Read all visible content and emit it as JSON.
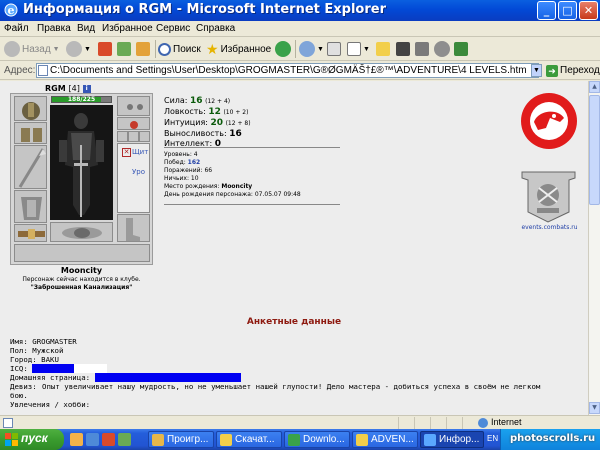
{
  "window": {
    "title": "Информация о RGM - Microsoft Internet Explorer"
  },
  "menu": [
    "Файл",
    "Правка",
    "Вид",
    "Избранное",
    "Сервис",
    "Справка"
  ],
  "toolbar": {
    "back_label": "Назад",
    "search_label": "Поиск",
    "favorites_label": "Избранное"
  },
  "address": {
    "label": "Адрес:",
    "url": "C:\\Documents and Settings\\User\\Desktop\\GROGMASTER\\G®ØGMÄŠ†£®™\\ADVENTURE\\4 LEVELS.htm",
    "go_label": "Переход"
  },
  "character": {
    "name": "RGM",
    "level": "[4]",
    "info_badge": "i",
    "hp_text": "188/225",
    "hp_fraction": 0.836,
    "side_labels": [
      "Щит",
      "Уро"
    ],
    "location_name": "Mooncity",
    "location_note_prefix": "Персонаж сейчас находится в клубе.",
    "location_place": "\"Заброшенная Канализация\""
  },
  "stats": [
    {
      "label": "Сила:",
      "value": "16",
      "bonus": "(12 + 4)"
    },
    {
      "label": "Ловкость:",
      "value": "12",
      "bonus": "(10 + 2)"
    },
    {
      "label": "Интуиция:",
      "value": "20",
      "bonus": "(12 + 8)"
    },
    {
      "label": "Выносливость:",
      "value": "16",
      "bonus": ""
    },
    {
      "label": "Интеллект:",
      "value": "0",
      "bonus": ""
    }
  ],
  "record": {
    "level_label": "Уровень:",
    "level": "4",
    "wins_label": "Побед:",
    "wins": "162",
    "losses_label": "Поражений:",
    "losses": "66",
    "draws_label": "Ничьих:",
    "draws": "10",
    "birthplace_label": "Место рождения:",
    "birthplace": "Mooncity",
    "birthday_label": "День рождения персонажа:",
    "birthday": "07.05.07 09:48"
  },
  "emblem_url": "events.combats.ru",
  "profile": {
    "section_title": "Анкетные данные",
    "name_label": "Имя:",
    "name": "GROGMASTER",
    "gender_label": "Пол:",
    "gender": "Мужской",
    "city_label": "Город:",
    "city": "BAKU",
    "icq_label": "ICQ:",
    "homepage_label": "Домашняя страница:",
    "motto_label": "Девиз:",
    "motto": "Опыт увеличивает нашу мудрость, но не уменьшает нашей глупости! Дело мастера - добиться успеха в своём не легком бою.",
    "hobbies_label": "Увлечения / хобби:"
  },
  "statusbar": {
    "zone": "Internet"
  },
  "taskbar": {
    "start_label": "пуск",
    "tasks": [
      "Проигр...",
      "Скачат...",
      "Downlo...",
      "ADVEN...",
      "Инфор..."
    ],
    "lang": "EN"
  },
  "watermark": "photoscrolls.ru"
}
